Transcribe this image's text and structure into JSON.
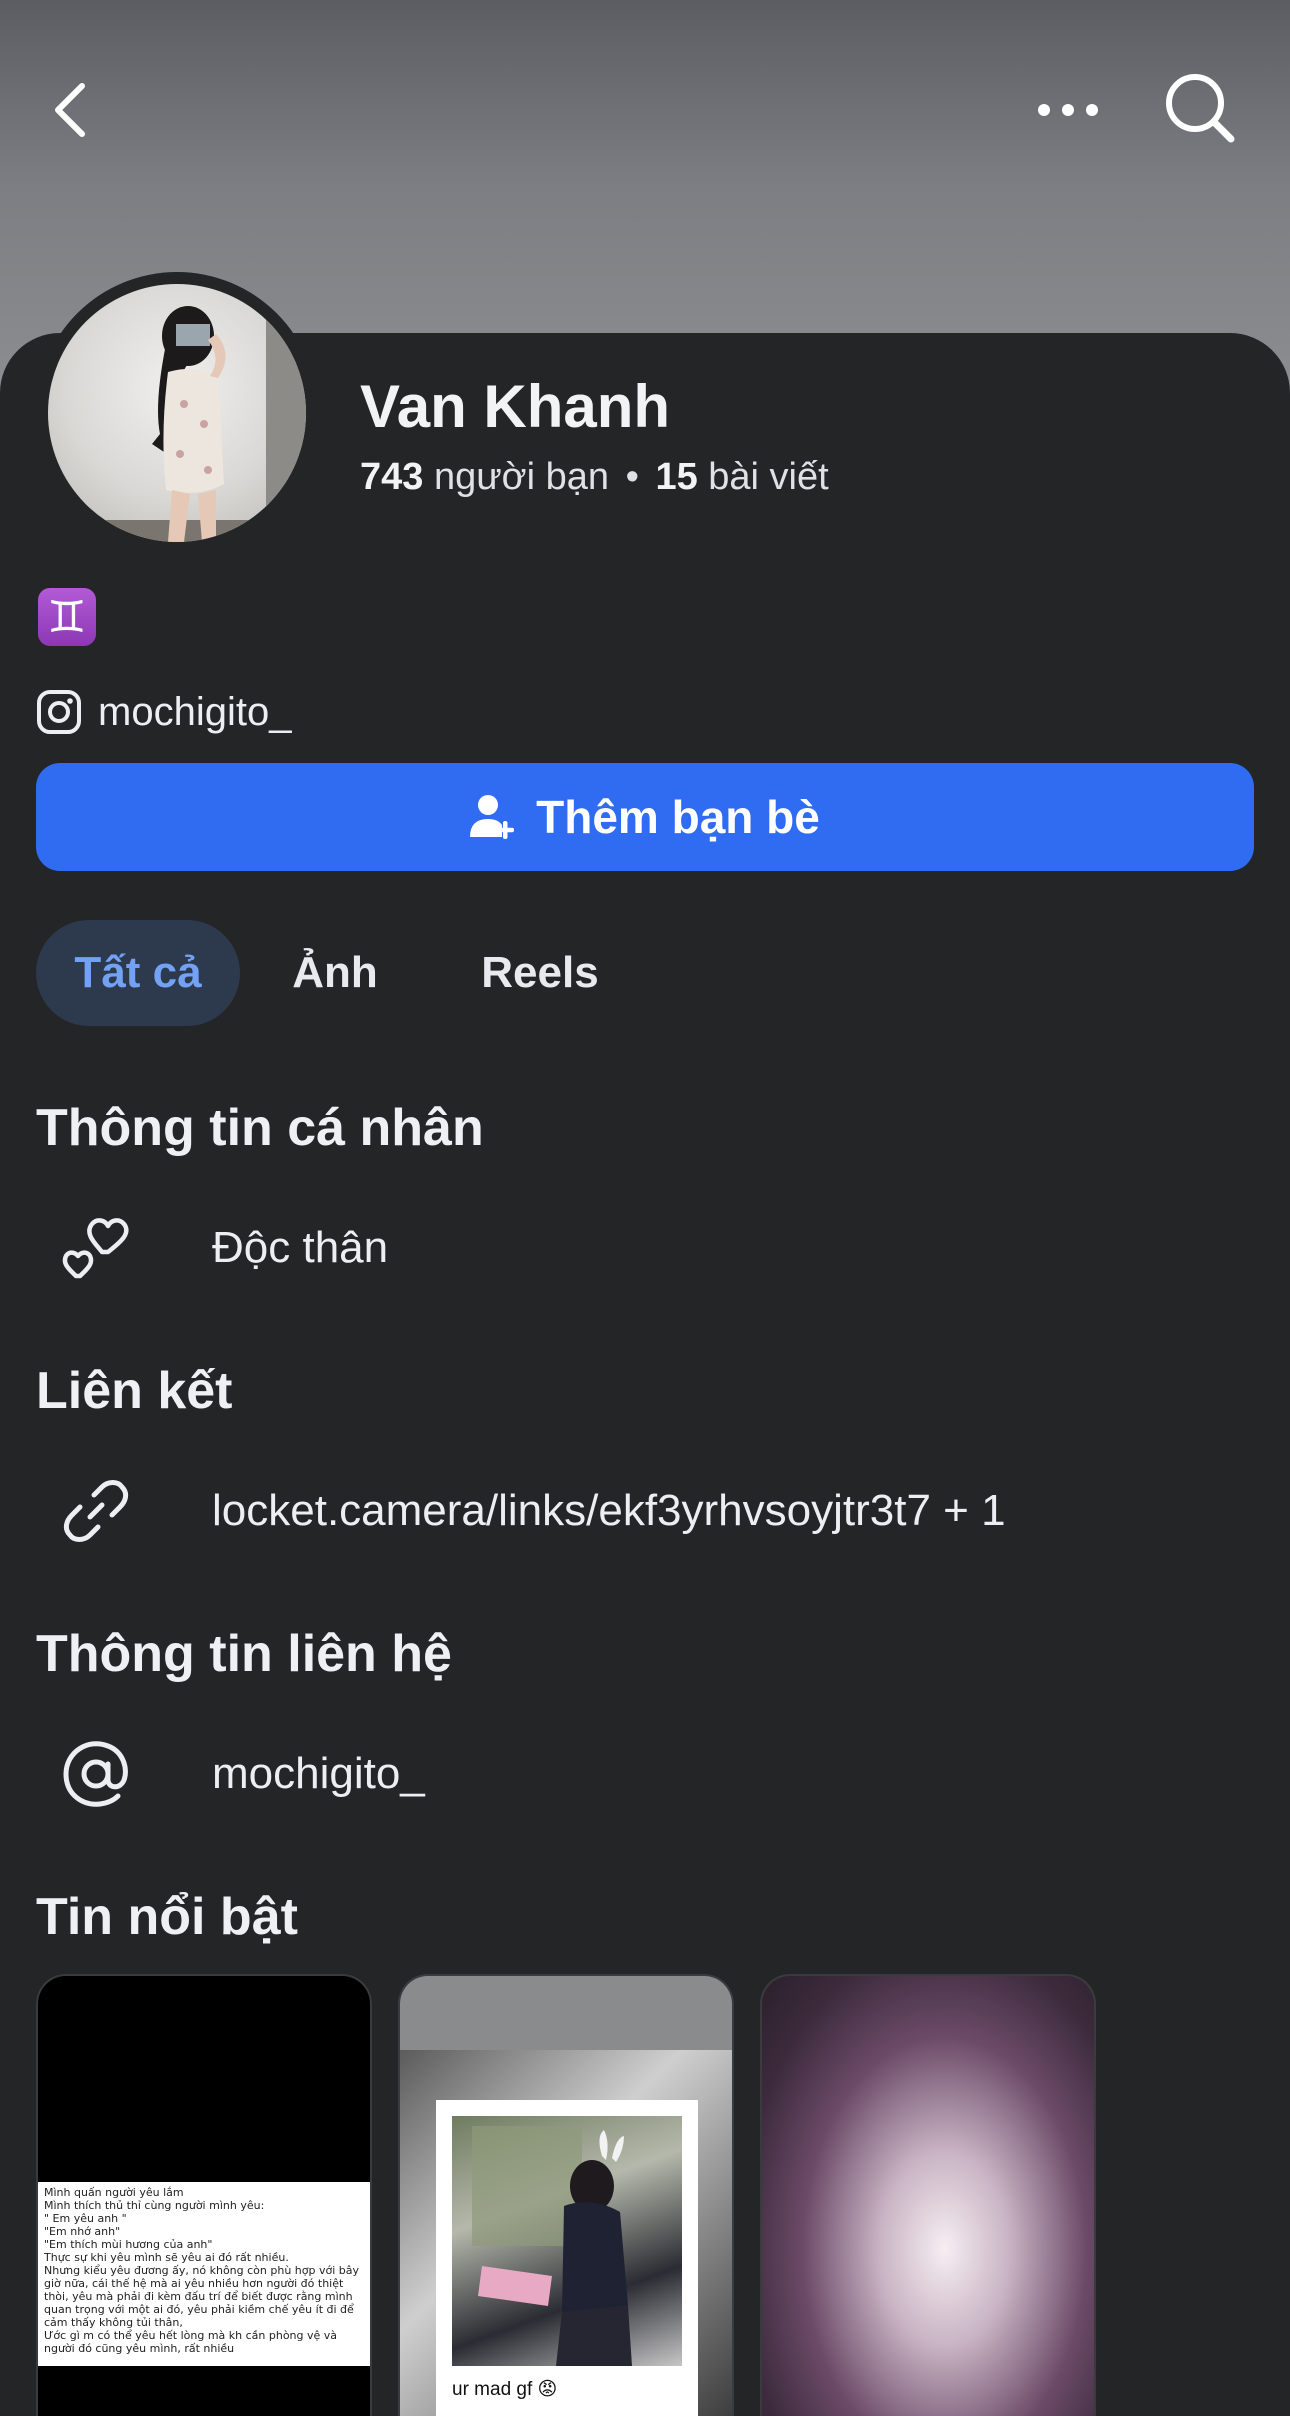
{
  "profile": {
    "name": "Van Khanh",
    "friends_count": "743",
    "friends_label": "người bạn",
    "separator": "•",
    "posts_count": "15",
    "posts_label": "bài viết",
    "zodiac_symbol": "♊",
    "instagram_handle": "mochigito_"
  },
  "actions": {
    "add_friend_label": "Thêm bạn bè"
  },
  "tabs": [
    {
      "label": "Tất cả",
      "active": true
    },
    {
      "label": "Ảnh",
      "active": false
    },
    {
      "label": "Reels",
      "active": false
    }
  ],
  "sections": {
    "personal_info": {
      "title": "Thông tin cá nhân",
      "relationship": "Độc thân"
    },
    "links": {
      "title": "Liên kết",
      "link": "locket.camera/links/ekf3yrhvsoyjtr3t7 + 1"
    },
    "contact": {
      "title": "Thông tin liên hệ",
      "handle": "mochigito_"
    },
    "highlights": {
      "title": "Tin nổi bật",
      "items": [
        {
          "note_lines": [
            "Mình quấn người yêu lắm",
            "Mình thích thủ thỉ cùng người mình yêu:",
            "\" Em yêu anh \"",
            "\"Em nhớ anh\"",
            "\"Em thích mùi hương của anh\"",
            "Thực sự khi yêu mình sẽ yêu ai đó rất nhiều.",
            "Nhưng kiểu yêu đương ấy, nó không còn phù hợp với bây giờ nữa, cái thế hệ mà ai yêu nhiều hơn người đó thiệt thòi, yêu mà phải đi kèm đấu trí để biết được rằng mình quan trọng với một ai đó, yêu phải kiềm chế yêu ít đi để cảm thấy không tủi thân,",
            "Ước gì m có thể yêu hết lòng mà kh cần phòng vệ  và người đó cũng yêu mình, rất nhiều"
          ]
        },
        {
          "caption": "ur mad gf 😡"
        },
        {}
      ]
    }
  },
  "colors": {
    "accent": "#2f6cf2",
    "active_tab_bg": "#2d3a4e",
    "active_tab_text": "#73a2f5",
    "background": "#242527"
  },
  "icons": [
    "back-icon",
    "more-icon",
    "search-icon",
    "instagram-icon",
    "add-person-icon",
    "hearts-icon",
    "link-icon",
    "at-icon"
  ]
}
